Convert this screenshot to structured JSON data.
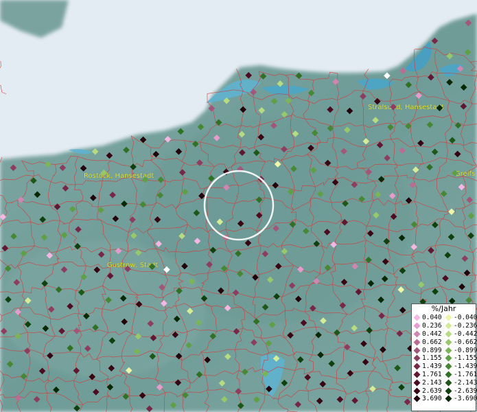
{
  "cities": [
    {
      "name": "Rostock, Hansestadt"
    },
    {
      "name": "Stralsund, Hansestadt"
    },
    {
      "name": "Greifs"
    },
    {
      "name": "Gustrow, Stadt"
    }
  ],
  "legend": {
    "title": "%/Jahr",
    "positive": [
      {
        "label": "0.040",
        "color": "#f4b6e3"
      },
      {
        "label": "0.236",
        "color": "#e59ccd"
      },
      {
        "label": "0.442",
        "color": "#cf86b1"
      },
      {
        "label": "0.662",
        "color": "#b96d95"
      },
      {
        "label": "0.899",
        "color": "#a3557a"
      },
      {
        "label": "1.155",
        "color": "#8d3d60"
      },
      {
        "label": "1.439",
        "color": "#772848"
      },
      {
        "label": "1.761",
        "color": "#611732"
      },
      {
        "label": "2.143",
        "color": "#4c0b20"
      },
      {
        "label": "2.639",
        "color": "#370312"
      },
      {
        "label": "3.690",
        "color": "#22000a"
      }
    ],
    "negative": [
      {
        "label": "-0.040",
        "color": "#eef7a8"
      },
      {
        "label": "-0.236",
        "color": "#d4ec96"
      },
      {
        "label": "-0.442",
        "color": "#b7db82"
      },
      {
        "label": "-0.662",
        "color": "#98c86c"
      },
      {
        "label": "-0.899",
        "color": "#7bb558"
      },
      {
        "label": "-1.155",
        "color": "#5f9f45"
      },
      {
        "label": "-1.439",
        "color": "#468835"
      },
      {
        "label": "-1.761",
        "color": "#307126"
      },
      {
        "label": "-2.143",
        "color": "#1e5819"
      },
      {
        "label": "-2.639",
        "color": "#0f400e"
      },
      {
        "label": "-3.690",
        "color": "#052805"
      }
    ]
  }
}
